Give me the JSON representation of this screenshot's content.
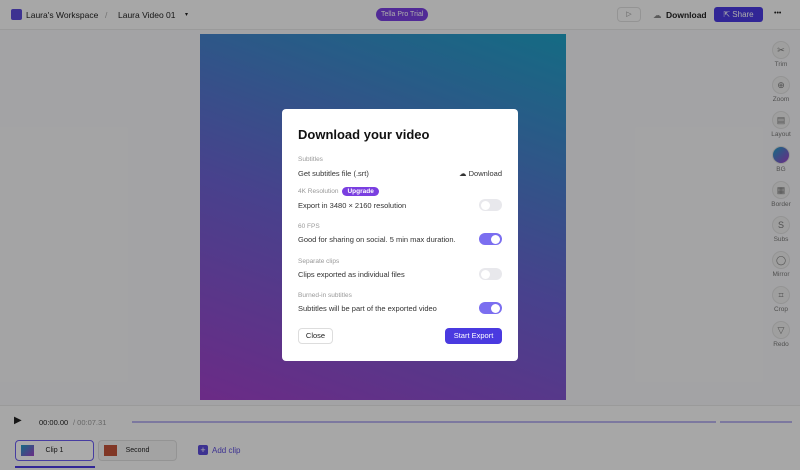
{
  "header": {
    "workspace": "Laura's Workspace",
    "separator": "/",
    "video_title": "Laura Video 01",
    "trial_badge": "Tella Pro Trial",
    "download_label": "Download",
    "share_label": "Share",
    "more": "•••"
  },
  "sidebar": [
    {
      "label": "Trim",
      "icon": "✂"
    },
    {
      "label": "Zoom",
      "icon": "⊕"
    },
    {
      "label": "Layout",
      "icon": "▤"
    },
    {
      "label": "BG",
      "icon": ""
    },
    {
      "label": "Border",
      "icon": "▦"
    },
    {
      "label": "Subs",
      "icon": "S"
    },
    {
      "label": "Mirror",
      "icon": "◯"
    },
    {
      "label": "Crop",
      "icon": "⌗"
    },
    {
      "label": "Redo",
      "icon": "▽"
    }
  ],
  "dialog": {
    "title": "Download your video",
    "subtitles": {
      "label": "Subtitles",
      "text": "Get subtitles file (.srt)",
      "action": "Download"
    },
    "res4k": {
      "label": "4K Resolution",
      "badge": "Upgrade",
      "text": "Export in 3480 × 2160 resolution",
      "enabled": false
    },
    "fps": {
      "label": "60 FPS",
      "text": "Good for sharing on social. 5 min max duration.",
      "enabled": true
    },
    "separate": {
      "label": "Separate clips",
      "text": "Clips exported as individual files",
      "enabled": false
    },
    "burned": {
      "label": "Burned-in subtitles",
      "text": "Subtitles will be part of the exported video",
      "enabled": true
    },
    "close": "Close",
    "export": "Start Export"
  },
  "player": {
    "current": "00:00.00",
    "total": " / 00:07.31"
  },
  "clips": [
    {
      "label": "Clip 1"
    },
    {
      "label": "Second"
    }
  ],
  "add_clip": "Add clip"
}
